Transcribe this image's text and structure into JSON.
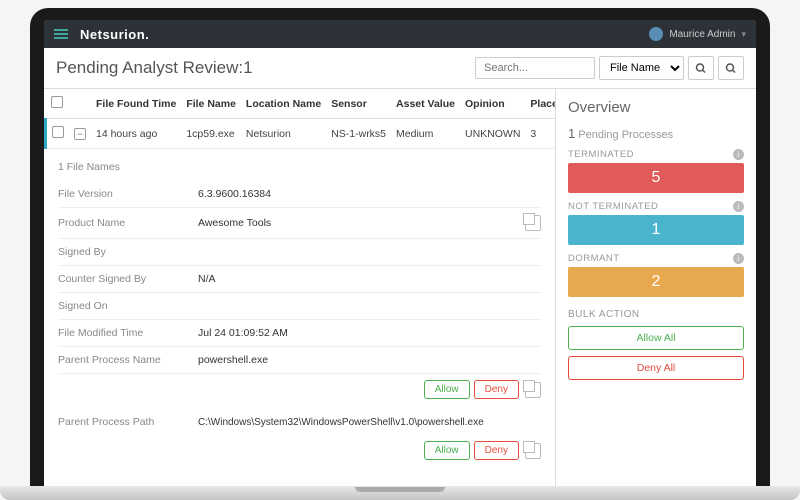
{
  "header": {
    "brand": "Netsurion.",
    "user": "Maurice Admin"
  },
  "page": {
    "title": "Pending Analyst Review:1"
  },
  "search": {
    "placeholder": "Search...",
    "filter": "File Name"
  },
  "columns": {
    "c0": "",
    "c1": "File Found Time",
    "c2": "File Name",
    "c3": "Location Name",
    "c4": "Sensor",
    "c5": "Asset Value",
    "c6": "Opinion",
    "c7": "Places"
  },
  "row": {
    "time": "14 hours ago",
    "file": "1cp59.exe",
    "location": "Netsurion",
    "sensor": "NS-1-wrks5",
    "asset": "Medium",
    "opinion": "UNKNOWN",
    "places": "3"
  },
  "detail": {
    "files_header": "1 File Names",
    "labels": {
      "version": "File Version",
      "product": "Product Name",
      "signed": "Signed By",
      "counter": "Counter Signed By",
      "signedon": "Signed On",
      "modified": "File Modified Time",
      "parent": "Parent Process Name",
      "path": "Parent Process Path"
    },
    "values": {
      "version": "6.3.9600.16384",
      "product": "Awesome Tools",
      "signed": "",
      "counter": "N/A",
      "signedon": "",
      "modified": "Jul 24 01:09:52 AM",
      "parent": "powershell.exe",
      "path": "C:\\Windows\\System32\\WindowsPowerShell\\v1.0\\powershell.exe"
    }
  },
  "actions": {
    "allow": "Allow",
    "deny": "Deny"
  },
  "overview": {
    "title": "Overview",
    "pending_num": "1",
    "pending_text": "Pending Processes",
    "terminated_label": "TERMINATED",
    "terminated_val": "5",
    "notterm_label": "NOT TERMINATED",
    "notterm_val": "1",
    "dormant_label": "DORMANT",
    "dormant_val": "2",
    "bulk_label": "BULK ACTION",
    "allow_all": "Allow All",
    "deny_all": "Deny All"
  }
}
